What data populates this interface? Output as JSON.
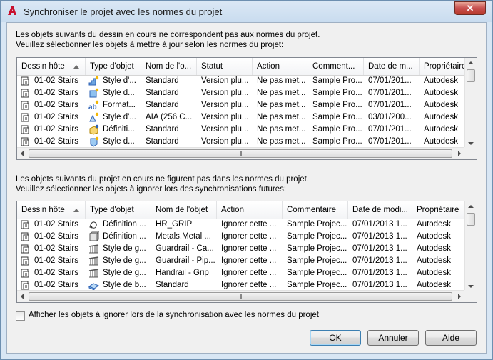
{
  "window": {
    "title": "Synchroniser le projet avec les normes du projet",
    "close_glyph": "✕"
  },
  "section1": {
    "line1": "Les objets suivants du dessin en cours ne correspondent pas aux normes du projet.",
    "line2": "Veuillez sélectionner les objets à mettre à jour selon les normes du projet:",
    "columns": [
      "Dessin hôte",
      "Type d'objet",
      "Nom de l'o...",
      "Statut",
      "Action",
      "Comment...",
      "Date de m...",
      "Propriétaire"
    ],
    "rows": [
      {
        "host": "01-02 Stairs",
        "icon": "stair-style-icon",
        "type": "Style d'...",
        "name": "Standard",
        "status": "Version plu...",
        "action": "Ne pas met...",
        "comment": "Sample Pro...",
        "date": "07/01/201...",
        "owner": "Autodesk"
      },
      {
        "host": "01-02 Stairs",
        "icon": "object-style-icon",
        "type": "Style d...",
        "name": "Standard",
        "status": "Version plu...",
        "action": "Ne pas met...",
        "comment": "Sample Pro...",
        "date": "07/01/201...",
        "owner": "Autodesk"
      },
      {
        "host": "01-02 Stairs",
        "icon": "text-format-icon",
        "type": "Format...",
        "name": "Standard",
        "status": "Version plu...",
        "action": "Ne pas met...",
        "comment": "Sample Pro...",
        "date": "07/01/201...",
        "owner": "Autodesk"
      },
      {
        "host": "01-02 Stairs",
        "icon": "dimension-style-icon",
        "type": "Style d'...",
        "name": "AIA (256 C...",
        "status": "Version plu...",
        "action": "Ne pas met...",
        "comment": "Sample Pro...",
        "date": "03/01/200...",
        "owner": "Autodesk"
      },
      {
        "host": "01-02 Stairs",
        "icon": "definition-icon",
        "type": "Définiti...",
        "name": "Standard",
        "status": "Version plu...",
        "action": "Ne pas met...",
        "comment": "Sample Pro...",
        "date": "07/01/201...",
        "owner": "Autodesk"
      },
      {
        "host": "01-02 Stairs",
        "icon": "shape-style-icon",
        "type": "Style d...",
        "name": "Standard",
        "status": "Version plu...",
        "action": "Ne pas met...",
        "comment": "Sample Pro...",
        "date": "07/01/201...",
        "owner": "Autodesk"
      }
    ]
  },
  "section2": {
    "line1": "Les objets suivants du projet en cours ne figurent pas dans les normes du projet.",
    "line2": "Veuillez sélectionner les objets à ignorer lors des synchronisations futures:",
    "columns": [
      "Dessin hôte",
      "Type d'objet",
      "Nom de l'objet",
      "Action",
      "Commentaire",
      "Date de modi...",
      "Propriétaire"
    ],
    "rows": [
      {
        "host": "01-02 Stairs",
        "icon": "profile-definition-icon",
        "type": "Définition ...",
        "name": "HR_GRIP",
        "action": "Ignorer cette ...",
        "comment": "Sample Projec...",
        "date": "07/01/2013 1...",
        "owner": "Autodesk"
      },
      {
        "host": "01-02 Stairs",
        "icon": "material-definition-icon",
        "type": "Définition ...",
        "name": "Metals.Metal ...",
        "action": "Ignorer cette ...",
        "comment": "Sample Projec...",
        "date": "07/01/2013 1...",
        "owner": "Autodesk"
      },
      {
        "host": "01-02 Stairs",
        "icon": "railing-style-icon",
        "type": "Style de g...",
        "name": "Guardrail - Ca...",
        "action": "Ignorer cette ...",
        "comment": "Sample Projec...",
        "date": "07/01/2013 1...",
        "owner": "Autodesk"
      },
      {
        "host": "01-02 Stairs",
        "icon": "railing-style-icon",
        "type": "Style de g...",
        "name": "Guardrail - Pip...",
        "action": "Ignorer cette ...",
        "comment": "Sample Projec...",
        "date": "07/01/2013 1...",
        "owner": "Autodesk"
      },
      {
        "host": "01-02 Stairs",
        "icon": "railing-style-icon",
        "type": "Style de g...",
        "name": "Handrail - Grip",
        "action": "Ignorer cette ...",
        "comment": "Sample Projec...",
        "date": "07/01/2013 1...",
        "owner": "Autodesk"
      },
      {
        "host": "01-02 Stairs",
        "icon": "slab-style-icon",
        "type": "Style de b...",
        "name": "Standard",
        "action": "Ignorer cette ...",
        "comment": "Sample Projec...",
        "date": "07/01/2013 1...",
        "owner": "Autodesk"
      }
    ]
  },
  "footer": {
    "checkbox_label": "Afficher les objets à ignorer lors de la synchronisation avec les normes du projet",
    "checkbox_checked": false,
    "ok_label": "OK",
    "cancel_label": "Annuler",
    "help_label": "Aide"
  },
  "colors": {
    "title_bg": "#c9dcef",
    "close_red": "#c75050",
    "accent_blue": "#2d62b5"
  }
}
